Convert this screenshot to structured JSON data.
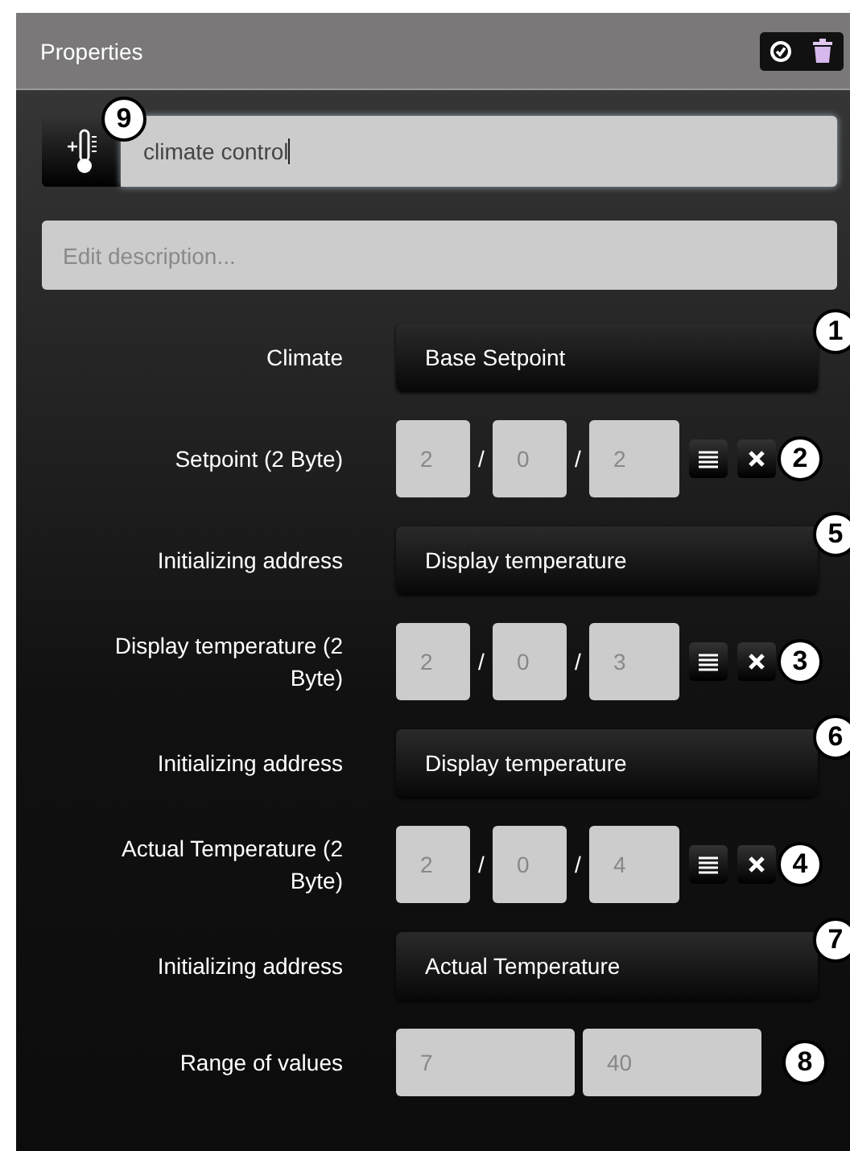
{
  "panel": {
    "title": "Properties"
  },
  "name_field": {
    "value": "climate control",
    "callout": "9"
  },
  "description_field": {
    "placeholder": "Edit description..."
  },
  "rows": [
    {
      "kind": "select",
      "label": "Climate",
      "value": "Base Setpoint",
      "callout": "1"
    },
    {
      "kind": "address",
      "label": "Setpoint (2 Byte)",
      "parts": [
        "2",
        "0",
        "2"
      ],
      "separators": [
        "/",
        "/"
      ],
      "callout": "2"
    },
    {
      "kind": "select",
      "label": "Initializing address",
      "value": "Display temperature",
      "callout": "5"
    },
    {
      "kind": "address",
      "label": "Display temperature (2 Byte)",
      "parts": [
        "2",
        "0",
        "3"
      ],
      "separators": [
        "/",
        "/"
      ],
      "callout": "3"
    },
    {
      "kind": "select",
      "label": "Initializing address",
      "value": "Display temperature",
      "callout": "6"
    },
    {
      "kind": "address",
      "label": "Actual Temperature (2 Byte)",
      "parts": [
        "2",
        "0",
        "4"
      ],
      "separators": [
        "/",
        "/"
      ],
      "callout": "4"
    },
    {
      "kind": "select",
      "label": "Initializing address",
      "value": "Actual Temperature",
      "callout": "7"
    },
    {
      "kind": "range",
      "label": "Range of values",
      "values": [
        "7",
        "40"
      ],
      "callout": "8"
    }
  ]
}
